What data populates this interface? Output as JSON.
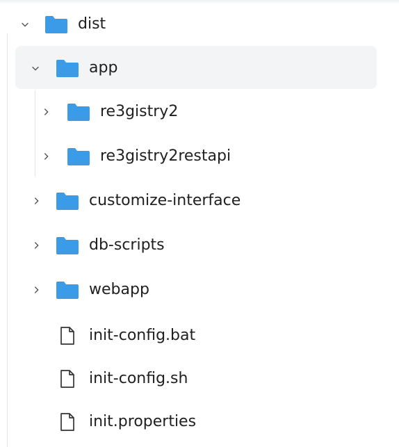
{
  "tree": {
    "root": {
      "label": "dist",
      "expanded": true
    },
    "app": {
      "label": "app",
      "expanded": true
    },
    "app_children": [
      {
        "label": "re3gistry2",
        "expanded": false
      },
      {
        "label": "re3gistry2restapi",
        "expanded": false
      }
    ],
    "folders": [
      {
        "label": "customize-interface",
        "expanded": false
      },
      {
        "label": "db-scripts",
        "expanded": false
      },
      {
        "label": "webapp",
        "expanded": false
      }
    ],
    "files": [
      {
        "label": "init-config.bat"
      },
      {
        "label": "init-config.sh"
      },
      {
        "label": "init.properties"
      }
    ]
  },
  "colors": {
    "folder": "#3b9be6",
    "selected_bg": "#f3f4f5",
    "chevron": "#555555",
    "file_outline": "#333333"
  },
  "icons": {
    "expanded": "chevron-down-icon",
    "collapsed": "chevron-right-icon",
    "folder": "folder-icon",
    "file": "file-icon"
  }
}
